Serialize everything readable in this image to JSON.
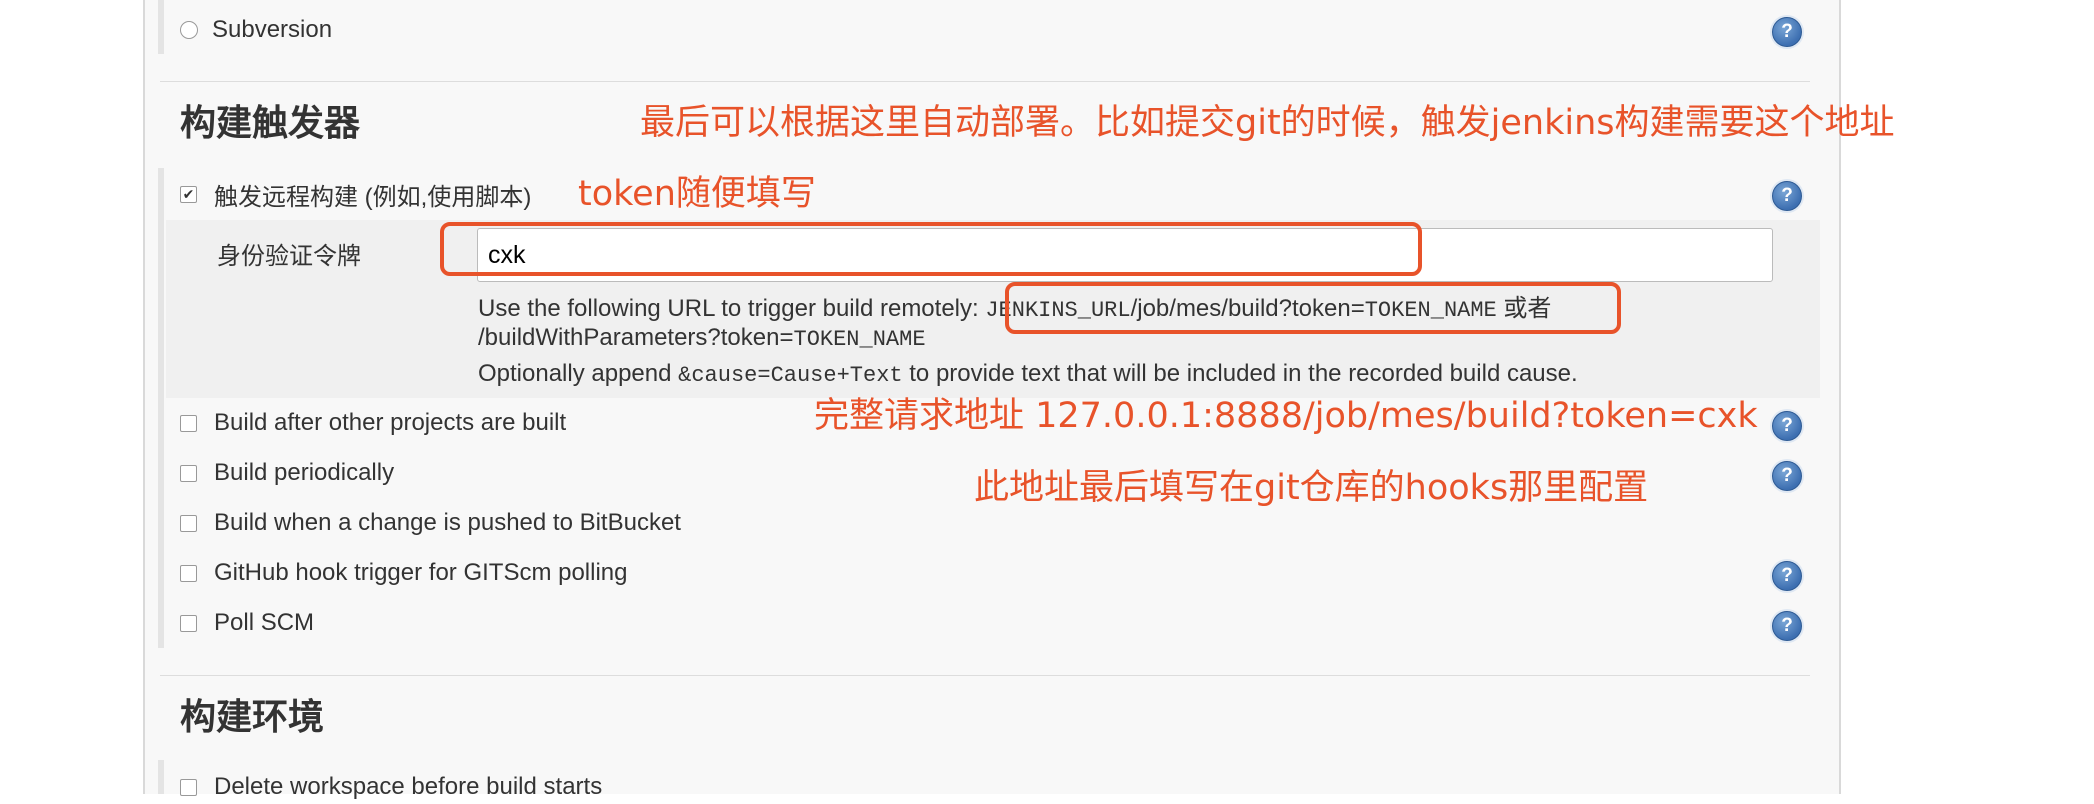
{
  "scm": {
    "subversion_label": "Subversion"
  },
  "triggers": {
    "section_title": "构建触发器",
    "remote": {
      "label": "触发远程构建 (例如,使用脚本)",
      "checked": true,
      "token_label": "身份验证令牌",
      "token_value": "cxk",
      "url_intro": "Use the following URL to trigger build remotely: ",
      "url_code_1": "JENKINS_URL",
      "url_path": "/job/mes/build?token=",
      "url_code_2": "TOKEN_NAME",
      "url_or": " 或者",
      "params_path": "/buildWithParameters?token=",
      "params_code": "TOKEN_NAME",
      "optional_prefix": "Optionally append ",
      "optional_code": "&cause=Cause+Text",
      "optional_suffix": " to provide text that will be included in the recorded build cause."
    },
    "options": [
      {
        "label": "Build after other projects are built",
        "checked": false
      },
      {
        "label": "Build periodically",
        "checked": false
      },
      {
        "label": "Build when a change is pushed to BitBucket",
        "checked": false
      },
      {
        "label": "GitHub hook trigger for GITScm polling",
        "checked": false
      },
      {
        "label": "Poll SCM",
        "checked": false
      }
    ]
  },
  "environment": {
    "section_title": "构建环境",
    "options": [
      {
        "label": "Delete workspace before build starts",
        "checked": false
      }
    ]
  },
  "annotations": {
    "top_note": "最后可以根据这里自动部署。比如提交git的时候，触发jenkins构建需要这个地址",
    "token_note": "token随便填写",
    "full_url_note": "完整请求地址 127.0.0.1:8888/job/mes/build?token=cxk",
    "hooks_note": "此地址最后填写在git仓库的hooks那里配置",
    "color": "#e8532a"
  },
  "help_icon_glyph": "?"
}
